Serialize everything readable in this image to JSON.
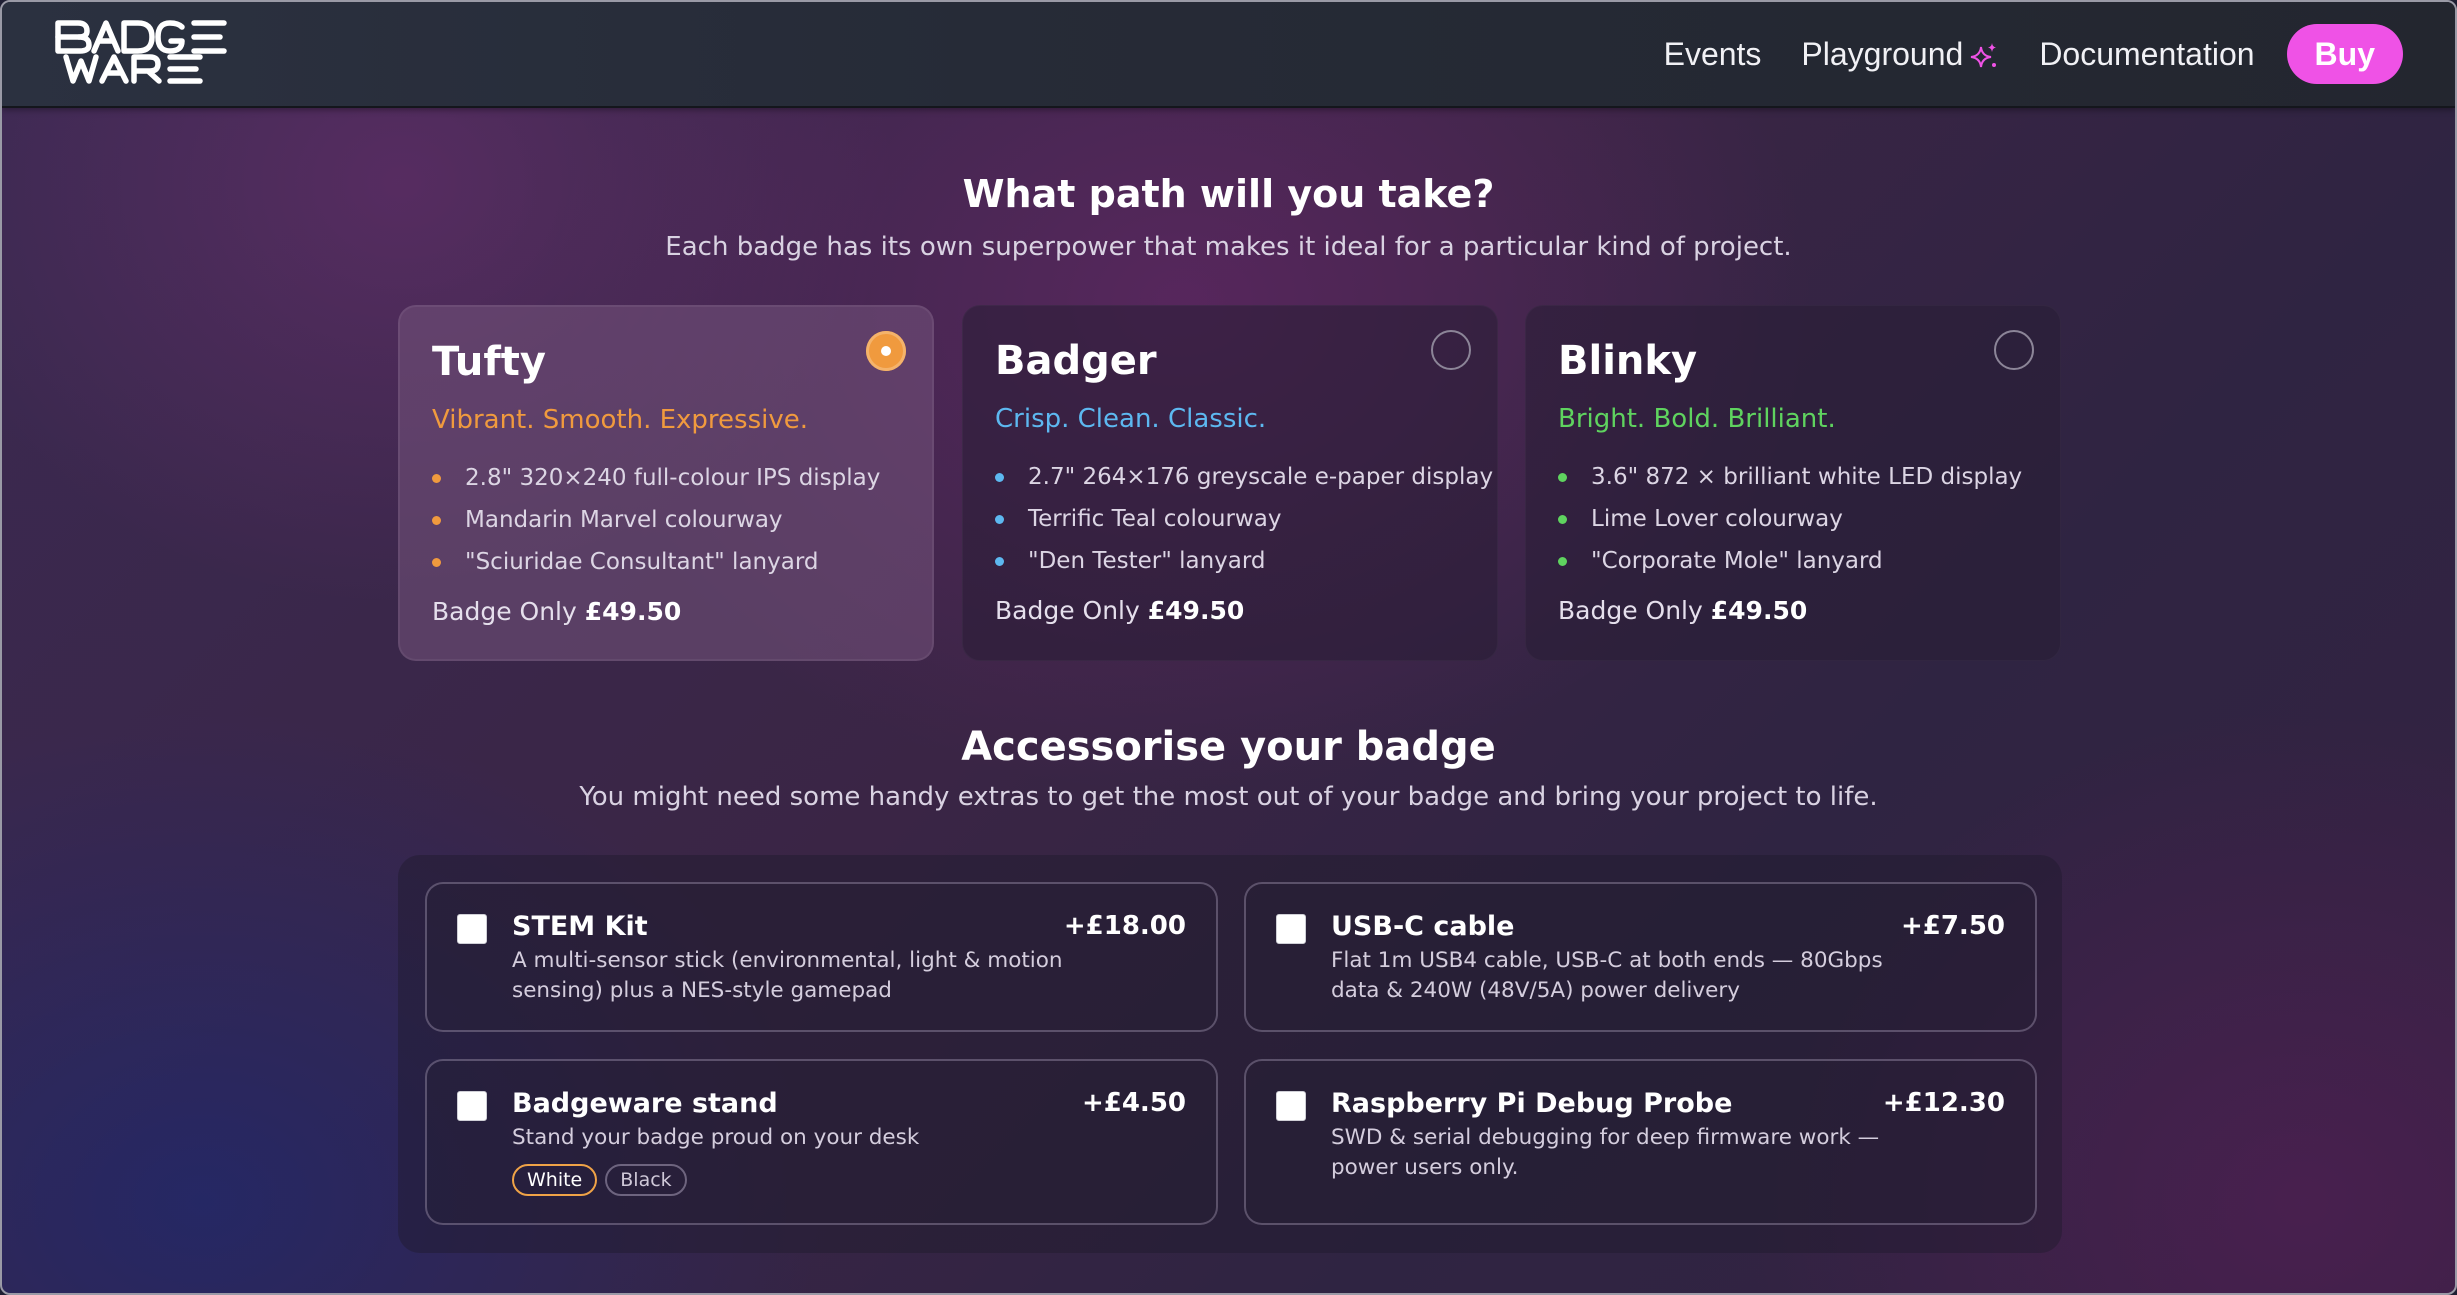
{
  "header": {
    "logo_text": "BADGEWARE",
    "nav": [
      {
        "label": "Events"
      },
      {
        "label": "Playground",
        "icon": "sparkle-icon"
      },
      {
        "label": "Documentation"
      }
    ],
    "buy_label": "Buy",
    "colors": {
      "buy": "#ef52e6",
      "sparkle": "#ef52e6"
    }
  },
  "path_section": {
    "title": "What path will you take?",
    "subtitle": "Each badge has its own superpower that makes it ideal for a particular kind of project."
  },
  "badges": [
    {
      "name": "Tufty",
      "tagline": "Vibrant. Smooth. Expressive.",
      "accent": "#f09a3e",
      "selected": true,
      "features": [
        "2.8\" 320×240 full-colour IPS display",
        "Mandarin Marvel colourway",
        "\"Sciuridae Consultant\" lanyard"
      ],
      "price_prefix": "Badge Only",
      "price": "£49.50"
    },
    {
      "name": "Badger",
      "tagline": "Crisp. Clean. Classic.",
      "accent": "#5db8f0",
      "selected": false,
      "features": [
        "2.7\" 264×176 greyscale e-paper display",
        "Terrific Teal colourway",
        "\"Den Tester\" lanyard"
      ],
      "price_prefix": "Badge Only",
      "price": "£49.50"
    },
    {
      "name": "Blinky",
      "tagline": "Bright. Bold. Brilliant.",
      "accent": "#5fd35f",
      "selected": false,
      "features": [
        "3.6\" 872 × brilliant white LED display",
        "Lime Lover colourway",
        "\"Corporate Mole\" lanyard"
      ],
      "price_prefix": "Badge Only",
      "price": "£49.50"
    }
  ],
  "accessories_section": {
    "title": "Accessorise your badge",
    "subtitle": "You might need some handy extras to get the most out of your badge and bring your project to life."
  },
  "accessories": [
    {
      "name": "STEM Kit",
      "price": "+£18.00",
      "description": "A multi-sensor stick (environmental, light & motion sensing) plus a NES-style gamepad",
      "checked": false
    },
    {
      "name": "USB-C cable",
      "price": "+£7.50",
      "description": "Flat 1m USB4 cable, USB-C at both ends — 80Gbps data & 240W (48V/5A) power delivery",
      "checked": false
    },
    {
      "name": "Badgeware stand",
      "price": "+£4.50",
      "description": "Stand your badge proud on your desk",
      "checked": false,
      "options": [
        {
          "label": "White",
          "selected": true
        },
        {
          "label": "Black",
          "selected": false
        }
      ]
    },
    {
      "name": "Raspberry Pi Debug Probe",
      "price": "+£12.30",
      "description": "SWD & serial debugging for deep firmware work — power users only.",
      "checked": false
    }
  ]
}
